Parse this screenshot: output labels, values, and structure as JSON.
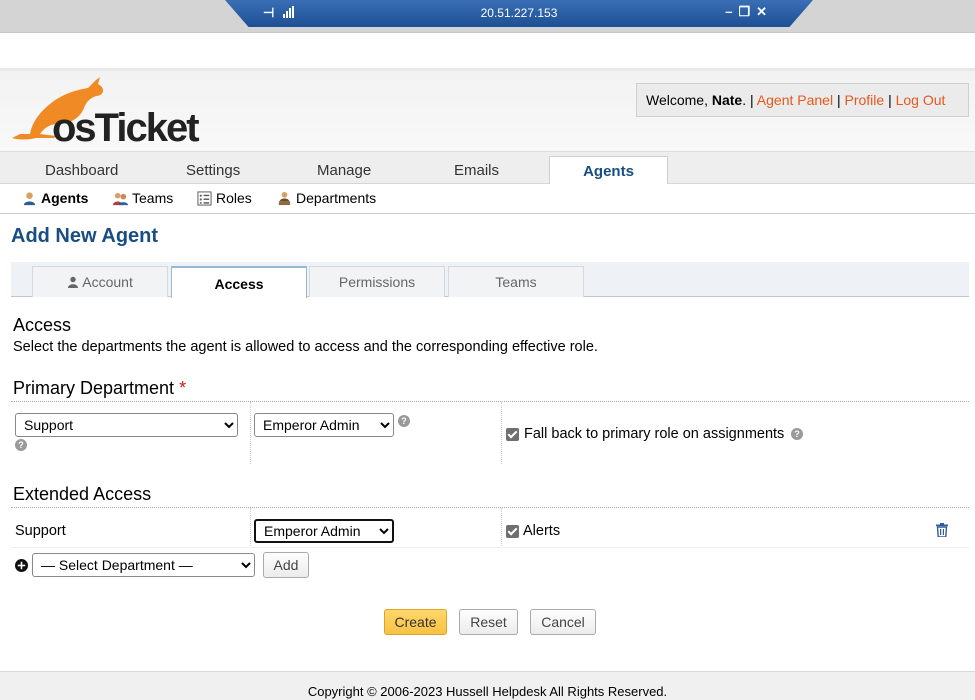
{
  "remote": {
    "ip": "20.51.227.153"
  },
  "header": {
    "logo_text": "osTicket",
    "welcome_prefix": "Welcome, ",
    "user": "Nate",
    "welcome_suffix": ".",
    "sep": " | ",
    "agent_panel": "Agent Panel",
    "profile": "Profile",
    "logout": "Log Out"
  },
  "nav": {
    "tabs": [
      "Dashboard",
      "Settings",
      "Manage",
      "Emails",
      "Agents"
    ],
    "active": "Agents"
  },
  "subnav": {
    "items": [
      "Agents",
      "Teams",
      "Roles",
      "Departments"
    ]
  },
  "page": {
    "title": "Add New Agent"
  },
  "form_tabs": {
    "items": [
      "Account",
      "Access",
      "Permissions",
      "Teams"
    ],
    "active": "Access"
  },
  "access": {
    "title": "Access",
    "description": "Select the departments the agent is allowed to access and the corresponding effective role.",
    "primary_title": "Primary Department",
    "required_mark": "*",
    "primary_department": "Support",
    "primary_role": "Emperor Admin",
    "fallback_label": "Fall back to primary role on assignments",
    "extended_title": "Extended Access",
    "extended_rows": [
      {
        "department": "Support",
        "role": "Emperor Admin",
        "alerts_label": "Alerts"
      }
    ],
    "select_department_placeholder": "— Select Department —",
    "add_label": "Add"
  },
  "actions": {
    "create": "Create",
    "reset": "Reset",
    "cancel": "Cancel"
  },
  "footer": {
    "copyright": "Copyright © 2006-2023 Hussell Helpdesk All Rights Reserved."
  },
  "colors": {
    "brand_orange": "#e8581c",
    "title_blue": "#184e81",
    "create_yellow": "#f7c244"
  }
}
